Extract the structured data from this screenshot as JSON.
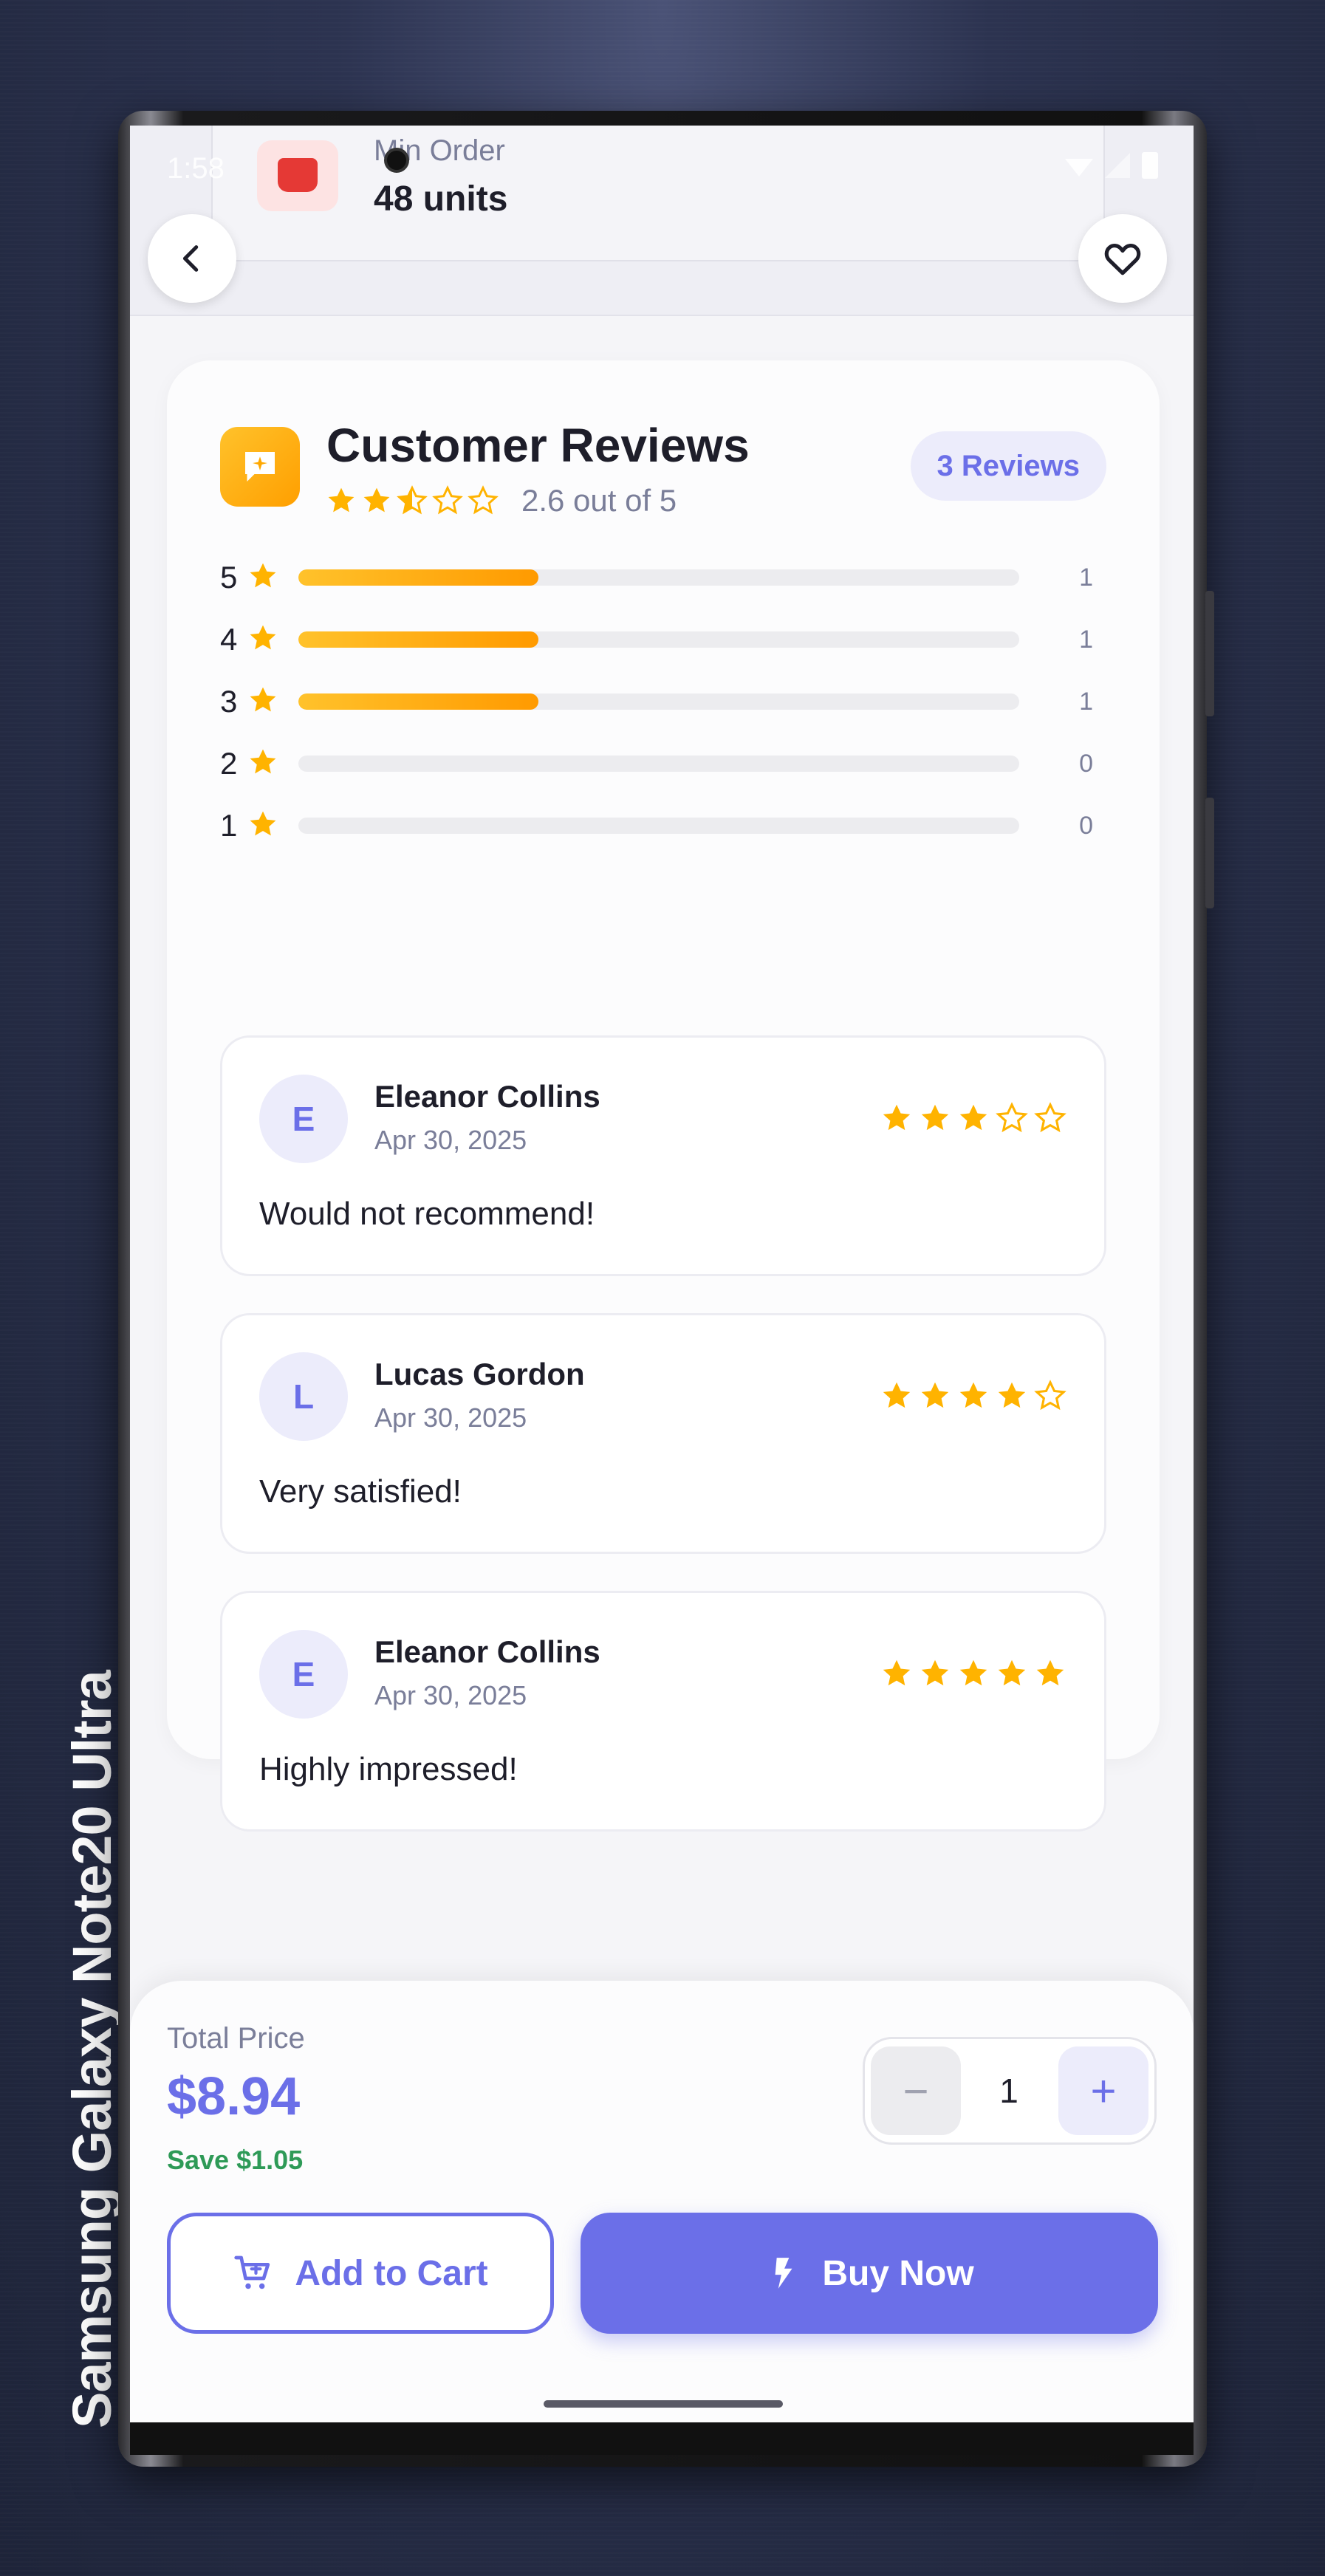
{
  "device": {
    "label": "Samsung Galaxy  Note20 Ultra"
  },
  "status_bar": {
    "time": "1:58"
  },
  "min_order": {
    "label": "Min Order",
    "value": "48 units"
  },
  "reviews": {
    "title": "Customer Reviews",
    "average_text": "2.6 out of 5",
    "average_value": 2.6,
    "count_badge": "3 Reviews",
    "distribution": [
      {
        "stars": "5",
        "count": "1",
        "fill_fraction": 0.333
      },
      {
        "stars": "4",
        "count": "1",
        "fill_fraction": 0.333
      },
      {
        "stars": "3",
        "count": "1",
        "fill_fraction": 0.333
      },
      {
        "stars": "2",
        "count": "0",
        "fill_fraction": 0
      },
      {
        "stars": "1",
        "count": "0",
        "fill_fraction": 0
      }
    ],
    "items": [
      {
        "initial": "E",
        "name": "Eleanor Collins",
        "date": "Apr 30, 2025",
        "rating": 3,
        "text": "Would not recommend!"
      },
      {
        "initial": "L",
        "name": "Lucas Gordon",
        "date": "Apr 30, 2025",
        "rating": 4,
        "text": "Very satisfied!"
      },
      {
        "initial": "E",
        "name": "Eleanor Collins",
        "date": "Apr 30, 2025",
        "rating": 5,
        "text": "Highly impressed!"
      }
    ]
  },
  "purchase": {
    "total_label": "Total Price",
    "total_value": "$8.94",
    "save_text": "Save $1.05",
    "quantity": "1",
    "minus_symbol": "−",
    "plus_symbol": "+",
    "add_to_cart_label": "Add to Cart",
    "buy_now_label": "Buy Now"
  },
  "colors": {
    "accent": "#6b6fe8",
    "star": "#ffb300",
    "save_green": "#2e9a57"
  },
  "icons": {
    "back": "chevron-left-icon",
    "favorite": "heart-icon",
    "reviews": "chat-sparkle-icon",
    "cart": "cart-icon",
    "buy": "bolt-icon"
  }
}
